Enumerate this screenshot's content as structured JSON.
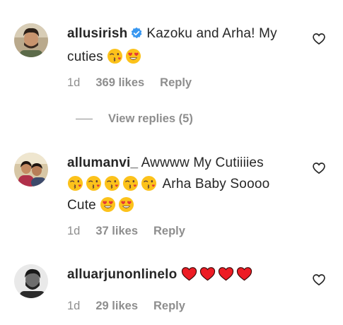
{
  "comments": [
    {
      "username": "allusirish",
      "verified": true,
      "line1": "Kazoku and Arha! My",
      "line2": "cuties",
      "age": "1d",
      "likes": "369 likes",
      "reply": "Reply"
    },
    {
      "username": "allumanvi_",
      "verified": false,
      "line1": "Awwww My Cutiiiies",
      "line2": "Arha Baby Soooo",
      "line3": "Cute",
      "age": "1d",
      "likes": "37 likes",
      "reply": "Reply"
    },
    {
      "username": "alluarjunonlinelo",
      "verified": false,
      "age": "1d",
      "likes": "29 likes",
      "reply": "Reply"
    }
  ],
  "view_replies": "View replies (5)",
  "colors": {
    "text": "#262626",
    "secondary": "#8e8e8e",
    "verified_blue": "#3897f0",
    "heart_red": "#ed1c24",
    "emoji_yellow": "#fcc21b"
  },
  "icons": {
    "like": "heart-outline-icon",
    "verified": "verified-badge-icon",
    "kiss_emoji": "face-blowing-kiss-emoji",
    "heart_eyes_emoji": "heart-eyes-emoji",
    "red_heart": "red-heart-emoji"
  }
}
